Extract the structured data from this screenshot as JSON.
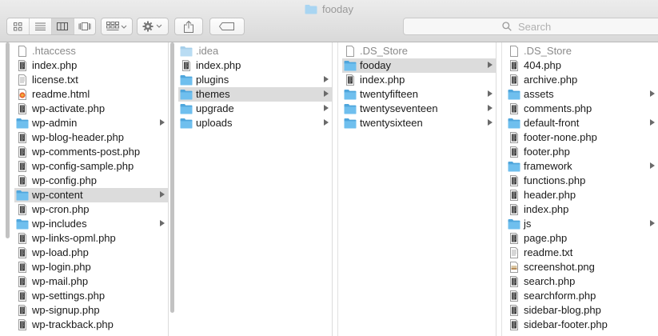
{
  "window": {
    "title": "fooday"
  },
  "toolbar": {
    "view_modes": [
      "icon-view-icon",
      "list-view-icon",
      "column-view-icon",
      "cover-flow-icon"
    ],
    "active_view": "column-view-icon",
    "arrange": "arrange-icon",
    "action": "gear-icon",
    "share": "share-icon",
    "tags": "tag-icon",
    "search_placeholder": "Search"
  },
  "colors": {
    "folder": "#6fbfee",
    "folder_dark": "#4fa6dc",
    "selected_row": "#dcdcdc",
    "title_text": "#9a9a9a"
  },
  "columns": [
    {
      "items": [
        {
          "name": ".htaccess",
          "type": "file",
          "hidden": true
        },
        {
          "name": "index.php",
          "type": "php"
        },
        {
          "name": "license.txt",
          "type": "text"
        },
        {
          "name": "readme.html",
          "type": "html"
        },
        {
          "name": "wp-activate.php",
          "type": "php"
        },
        {
          "name": "wp-admin",
          "type": "folder"
        },
        {
          "name": "wp-blog-header.php",
          "type": "php"
        },
        {
          "name": "wp-comments-post.php",
          "type": "php"
        },
        {
          "name": "wp-config-sample.php",
          "type": "php"
        },
        {
          "name": "wp-config.php",
          "type": "php"
        },
        {
          "name": "wp-content",
          "type": "folder",
          "selected": true
        },
        {
          "name": "wp-cron.php",
          "type": "php"
        },
        {
          "name": "wp-includes",
          "type": "folder"
        },
        {
          "name": "wp-links-opml.php",
          "type": "php"
        },
        {
          "name": "wp-load.php",
          "type": "php"
        },
        {
          "name": "wp-login.php",
          "type": "php"
        },
        {
          "name": "wp-mail.php",
          "type": "php"
        },
        {
          "name": "wp-settings.php",
          "type": "php"
        },
        {
          "name": "wp-signup.php",
          "type": "php"
        },
        {
          "name": "wp-trackback.php",
          "type": "php"
        }
      ]
    },
    {
      "items": [
        {
          "name": ".idea",
          "type": "folder-light",
          "hidden": true
        },
        {
          "name": "index.php",
          "type": "php"
        },
        {
          "name": "plugins",
          "type": "folder"
        },
        {
          "name": "themes",
          "type": "folder",
          "selected": true
        },
        {
          "name": "upgrade",
          "type": "folder"
        },
        {
          "name": "uploads",
          "type": "folder"
        }
      ]
    },
    {
      "items": [
        {
          "name": ".DS_Store",
          "type": "file",
          "hidden": true
        },
        {
          "name": "fooday",
          "type": "folder",
          "selected": true
        },
        {
          "name": "index.php",
          "type": "php"
        },
        {
          "name": "twentyfifteen",
          "type": "folder"
        },
        {
          "name": "twentyseventeen",
          "type": "folder"
        },
        {
          "name": "twentysixteen",
          "type": "folder"
        }
      ]
    },
    {
      "items": [
        {
          "name": ".DS_Store",
          "type": "file",
          "hidden": true
        },
        {
          "name": "404.php",
          "type": "php"
        },
        {
          "name": "archive.php",
          "type": "php"
        },
        {
          "name": "assets",
          "type": "folder"
        },
        {
          "name": "comments.php",
          "type": "php"
        },
        {
          "name": "default-front",
          "type": "folder"
        },
        {
          "name": "footer-none.php",
          "type": "php"
        },
        {
          "name": "footer.php",
          "type": "php"
        },
        {
          "name": "framework",
          "type": "folder"
        },
        {
          "name": "functions.php",
          "type": "php"
        },
        {
          "name": "header.php",
          "type": "php"
        },
        {
          "name": "index.php",
          "type": "php"
        },
        {
          "name": "js",
          "type": "folder"
        },
        {
          "name": "page.php",
          "type": "php"
        },
        {
          "name": "readme.txt",
          "type": "text"
        },
        {
          "name": "screenshot.png",
          "type": "image"
        },
        {
          "name": "search.php",
          "type": "php"
        },
        {
          "name": "searchform.php",
          "type": "php"
        },
        {
          "name": "sidebar-blog.php",
          "type": "php"
        },
        {
          "name": "sidebar-footer.php",
          "type": "php"
        }
      ]
    }
  ]
}
